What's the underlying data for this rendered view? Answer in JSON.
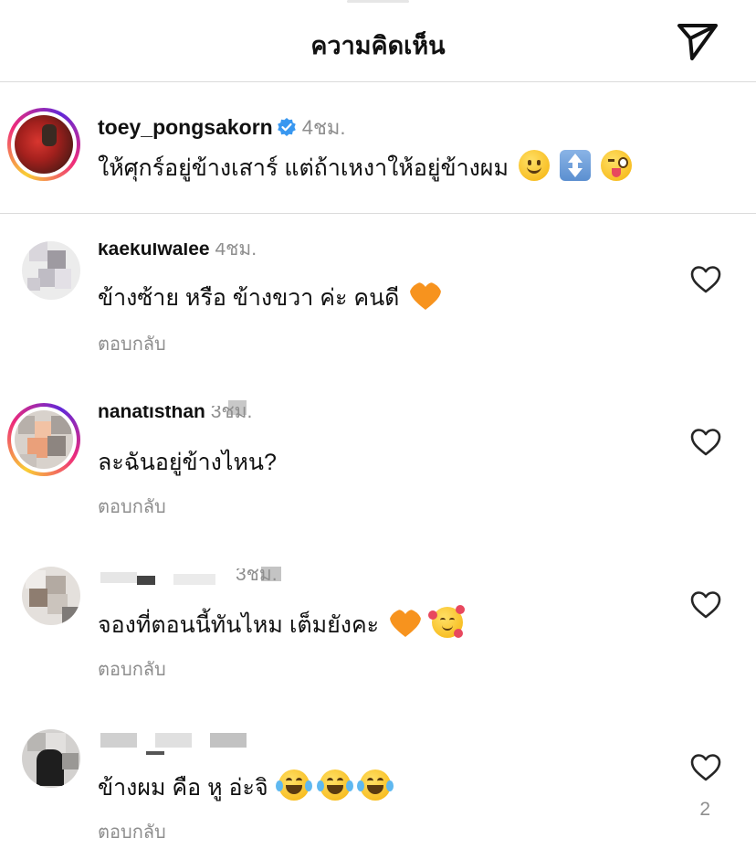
{
  "header": {
    "title": "ความคิดเห็น"
  },
  "post": {
    "username": "toey_pongsakorn",
    "time": "4ชม.",
    "caption": "ให้ศุกร์อยู่ข้างเสาร์ แต่ถ้าเหงาให้อยู่ข้างผม"
  },
  "comments": [
    {
      "username": "kaekulwalee",
      "time": "4ชม.",
      "text": "ข้างซ้าย หรือ ข้างขวา ค่ะ คนดี",
      "reply": "ตอบกลับ"
    },
    {
      "username": "nanatisthan",
      "time": "3ชม.",
      "text": "ละฉันอยู่ข้างไหน?",
      "reply": "ตอบกลับ"
    },
    {
      "username": "",
      "time": "3ชม.",
      "text": "จองที่ตอนนี้ทันไหม เต็มยังคะ",
      "reply": "ตอบกลับ"
    },
    {
      "username": "",
      "time": "",
      "text": "ข้างผม คือ หู อ่ะจิ",
      "reply": "ตอบกลับ",
      "likes": "2"
    }
  ],
  "icons": [
    "send-icon",
    "verified-badge-icon",
    "heart-icon",
    "emoji-slightly-smiling",
    "emoji-up-down-arrow",
    "emoji-winking-tongue",
    "emoji-orange-heart",
    "emoji-smiling-hearts",
    "emoji-tears-of-joy"
  ],
  "colors": {
    "link_gray": "#8e8e8e",
    "divider": "#dbdbdb",
    "verified_blue": "#3897f0",
    "orange_heart": "#f7931e"
  }
}
